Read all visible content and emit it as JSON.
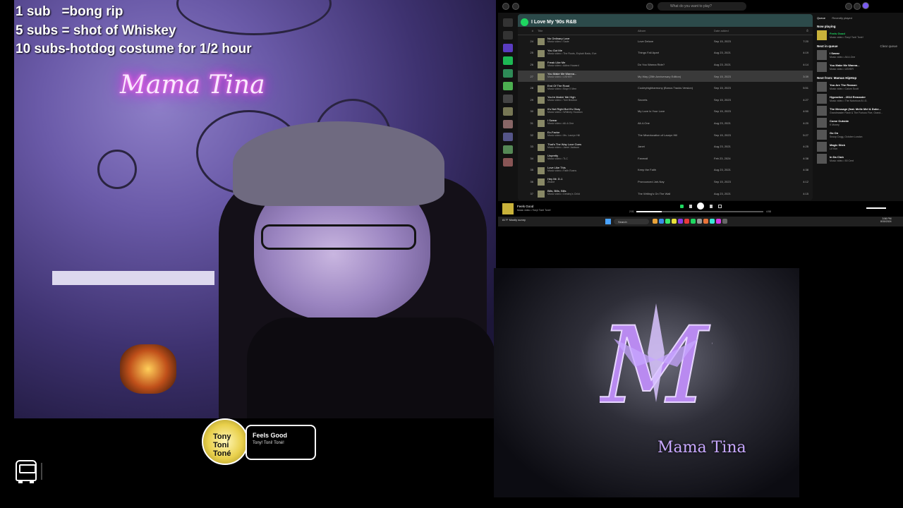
{
  "overlay": {
    "subs_rules": "1 sub   =bong rip\n5 subs = shot of Whiskey\n10 subs-hotdog costume for 1/2 hour",
    "neon_sign": "Mama Tina",
    "bus_icon": "bus-icon"
  },
  "now_playing_widget": {
    "title": "Feels Good",
    "artist": "Tony! Toni! Toné!",
    "art_label": "Tony Toni Toné"
  },
  "spotify": {
    "search_placeholder": "What do you want to play?",
    "playlist_title": "I Love My '90s R&B",
    "columns": {
      "num": "#",
      "title": "Title",
      "album": "Album",
      "date": "Date added",
      "time": "⏱"
    },
    "tracks": [
      {
        "n": "24",
        "title": "No Ordinary Love",
        "artist": "Music video • Sade",
        "album": "Love Deluxe",
        "date": "Sep 15, 2023",
        "time": "7:20"
      },
      {
        "n": "25",
        "title": "You Got Me",
        "artist": "Music video • The Roots, Erykah Badu, Eve",
        "album": "Things Fall Apart",
        "date": "Aug 23, 2021",
        "time": "4:19"
      },
      {
        "n": "26",
        "title": "Freak Like Me",
        "artist": "Music video • Adina Howard",
        "album": "Do You Wanna Ride?",
        "date": "Aug 23, 2021",
        "time": "4:14"
      },
      {
        "n": "27",
        "title": "You Make Me Wanna...",
        "artist": "Music video • USHER",
        "album": "My Way (25th Anniversary Edition)",
        "date": "Sep 15, 2023",
        "time": "3:39"
      },
      {
        "n": "28",
        "title": "End Of The Road",
        "artist": "Music video • Boyz II Men",
        "album": "Cooleyhighharmony (Bonus Tracks Version)",
        "date": "Sep 15, 2023",
        "time": "5:51"
      },
      {
        "n": "29",
        "title": "You're Makin' Me High",
        "artist": "Music video • Toni Braxton",
        "album": "Secrets",
        "date": "Sep 15, 2023",
        "time": "4:27"
      },
      {
        "n": "30",
        "title": "It's Not Right But It's Okay",
        "artist": "Music video • Whitney Houston",
        "album": "My Love Is Your Love",
        "date": "Sep 15, 2023",
        "time": "4:50"
      },
      {
        "n": "31",
        "title": "I Swear",
        "artist": "Music video • All-4-One",
        "album": "All-4-One",
        "date": "Aug 23, 2021",
        "time": "4:20"
      },
      {
        "n": "32",
        "title": "Ex-Factor",
        "artist": "Music video • Ms. Lauryn Hill",
        "album": "The Miseducation of Lauryn Hill",
        "date": "Sep 15, 2023",
        "time": "5:27"
      },
      {
        "n": "33",
        "title": "That's The Way Love Goes",
        "artist": "Music video • Janet Jackson",
        "album": "Janet",
        "date": "Aug 23, 2021",
        "time": "4:25"
      },
      {
        "n": "34",
        "title": "Unpretty",
        "artist": "Music video • TLC",
        "album": "Fanmail",
        "date": "Feb 23, 2024",
        "time": "4:38"
      },
      {
        "n": "35",
        "title": "Love Like This",
        "artist": "Music video • Faith Evans",
        "album": "Keep the Faith",
        "date": "Aug 23, 2021",
        "time": "4:38"
      },
      {
        "n": "36",
        "title": "Hey Mr. D.J.",
        "artist": "Zhané",
        "album": "Pronounced Jah-Nay",
        "date": "Sep 15, 2023",
        "time": "4:12"
      },
      {
        "n": "37",
        "title": "Bills, Bills, Bills",
        "artist": "Music video • Destiny's Child",
        "album": "The Writing's On The Wall",
        "date": "Aug 23, 2021",
        "time": "4:15"
      }
    ],
    "queue": {
      "tab_queue": "Queue",
      "tab_recent": "Recently played",
      "now_playing_label": "Now playing",
      "now": {
        "title": "Feels Good",
        "sub": "Music video • Tony! Toni! Toné!"
      },
      "next_label": "Next in queue",
      "clear": "Clear queue",
      "next": [
        {
          "title": "I Swear",
          "sub": "Music video • All-4-One"
        },
        {
          "title": "You Make Me Wanna...",
          "sub": "Music video • USHER"
        }
      ],
      "from_label": "Next from: Mamas HipHop",
      "from": [
        {
          "title": "You Are The Reason",
          "sub": "Music video • Calum Scott"
        },
        {
          "title": "Hypnotize - 2014 Remaster",
          "sub": "Music video • The Notorious B.I.G."
        },
        {
          "title": "The Message (feat. Melle Mel & Duke...",
          "sub": "Grandmaster Flash & The Furious Five, Grand..."
        },
        {
          "title": "Come Outside",
          "sub": "K Money"
        },
        {
          "title": "Go On",
          "sub": "Snoop Dogg, October London"
        },
        {
          "title": "Magic Stick",
          "sub": "Lil' Kim"
        },
        {
          "title": "In Da Club",
          "sub": "Music video • 50 Cent"
        }
      ]
    },
    "player": {
      "title": "Feels Good",
      "sub": "Music video • Tony! Toni! Toné!",
      "elapsed": "2:01",
      "total": "4:58",
      "progress": 0.2
    },
    "taskbar": {
      "search": "Search",
      "weather": "81°F",
      "weather_sub": "Mostly sunny",
      "time": "3:56 PM",
      "date": "8/30/2024"
    }
  },
  "logo": {
    "text": "Mama Tina",
    "monogram": "MT"
  }
}
